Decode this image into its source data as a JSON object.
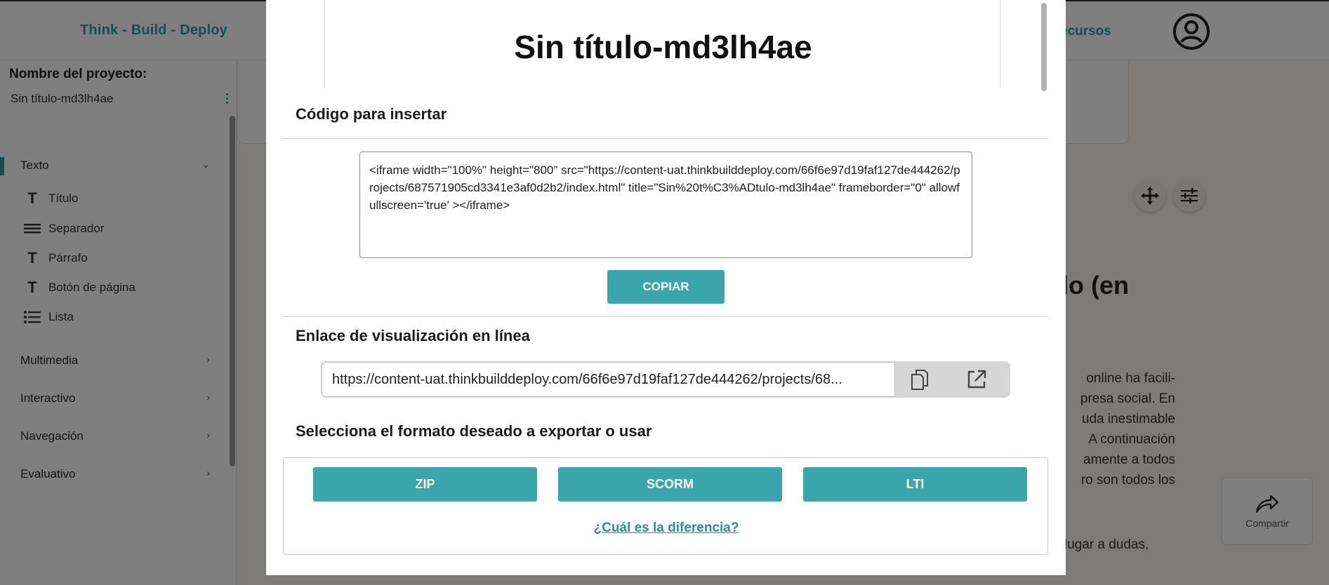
{
  "header": {
    "brand": "Think - Build - Deploy",
    "nav_recursos": "ecursos",
    "user_icon": "account-circle-icon"
  },
  "sidebar": {
    "project_label": "Nombre del proyecto:",
    "project_name": "Sin título-md3lh4ae",
    "sections": [
      {
        "label": "Texto",
        "expanded": true
      },
      {
        "label": "Multimedia"
      },
      {
        "label": "Interactivo"
      },
      {
        "label": "Navegación"
      },
      {
        "label": "Evaluativo"
      }
    ],
    "text_items": [
      {
        "label": "Título",
        "icon": "text-t-icon"
      },
      {
        "label": "Separador",
        "icon": "separator-lines-icon"
      },
      {
        "label": "Párrafo",
        "icon": "text-t-icon"
      },
      {
        "label": "Botón de página",
        "icon": "text-t-icon"
      },
      {
        "label": "Lista",
        "icon": "list-icon"
      }
    ]
  },
  "background": {
    "heading_fragment": "do (en",
    "para_lines": [
      "online ha facili-",
      "presa social. En",
      "uda inestimable",
      "A continuación",
      "amente a todos",
      "ro son todos los"
    ],
    "para2": "n lugar a dudas,",
    "share_label": "Compartir"
  },
  "modal": {
    "preview_title": "Sin título-md3lh4ae",
    "embed_title": "Código para insertar",
    "embed_code": "<iframe width=\"100%\" height=\"800\" src=\"https://content-uat.thinkbuilddeploy.com/66f6e97d19faf127de444262/projects/687571905cd3341e3af0d2b2/index.html\" title=\"Sin%20t%C3%ADtulo-md3lh4ae\" frameborder=\"0\" allowfullscreen='true' ></iframe>",
    "copy_label": "COPIAR",
    "link_title": "Enlace de visualización en línea",
    "link_url": "https://content-uat.thinkbuilddeploy.com/66f6e97d19faf127de444262/projects/68...",
    "export_title": "Selecciona el formato deseado a exportar o usar",
    "formats": [
      "ZIP",
      "SCORM",
      "LTI"
    ],
    "difference_link": "¿Cuál es la diferencia?"
  },
  "colors": {
    "accent": "#3aa6ac",
    "brand": "#2f9aa0"
  }
}
